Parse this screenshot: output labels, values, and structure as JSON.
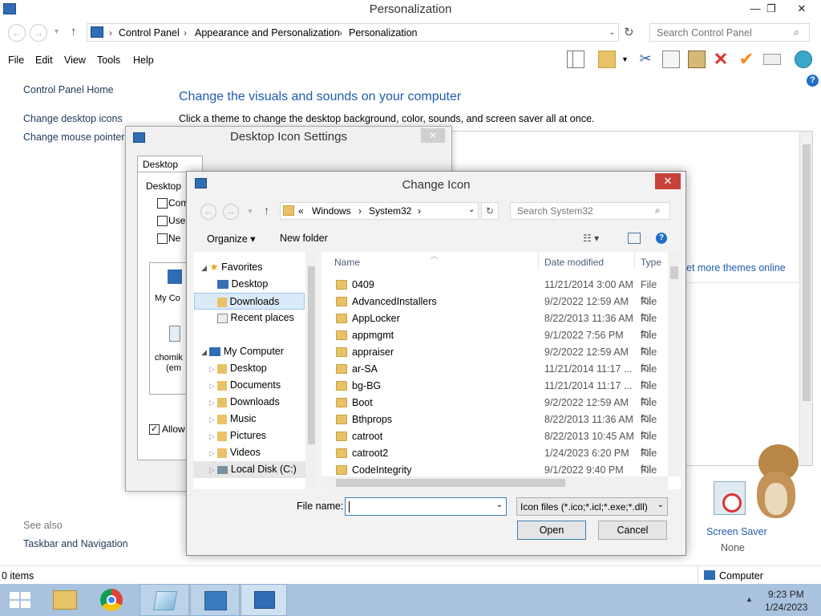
{
  "window": {
    "title": "Personalization",
    "min": "—",
    "max": "❐",
    "close": "✕"
  },
  "address": {
    "crumbs": [
      "Control Panel",
      "Appearance and Personalization",
      "Personalization"
    ],
    "search_placeholder": "Search Control Panel"
  },
  "menu": [
    "File",
    "Edit",
    "View",
    "Tools",
    "Help"
  ],
  "left_pane": {
    "home": "Control Panel Home",
    "links": [
      "Change desktop icons",
      "Change mouse pointers"
    ],
    "see_also": "See also",
    "see_also_links": [
      "Taskbar and Navigation"
    ]
  },
  "main": {
    "heading": "Change the visuals and sounds on your computer",
    "subtext": "Click a theme to change the desktop background, color, sounds, and screen saver all at once.",
    "more_themes": "et more themes online",
    "screensaver_label": "Screen Saver",
    "screensaver_value": "None"
  },
  "desktop_icon_settings": {
    "title": "Desktop Icon Settings",
    "tab": "Desktop Icons",
    "group": "Desktop",
    "checkboxes": [
      "Com",
      "Use",
      "Ne"
    ],
    "icons": [
      "My Co",
      "chomik",
      "(em"
    ],
    "allow": "Allow"
  },
  "change_icon": {
    "title": "Change Icon",
    "path": [
      "«",
      "Windows",
      "System32"
    ],
    "search_placeholder": "Search System32",
    "organize": "Organize",
    "new_folder": "New folder",
    "tree": {
      "favorites": "Favorites",
      "fav_items": [
        "Desktop",
        "Downloads",
        "Recent places"
      ],
      "computer": "My Computer",
      "comp_items": [
        "Desktop",
        "Documents",
        "Downloads",
        "Music",
        "Pictures",
        "Videos",
        "Local Disk (C:)"
      ]
    },
    "columns": {
      "name": "Name",
      "date": "Date modified",
      "type": "Type"
    },
    "files": [
      {
        "name": "0409",
        "date": "11/21/2014 3:00 AM",
        "type": "File fol"
      },
      {
        "name": "AdvancedInstallers",
        "date": "9/2/2022 12:59 AM",
        "type": "File fol"
      },
      {
        "name": "AppLocker",
        "date": "8/22/2013 11:36 AM",
        "type": "File fol"
      },
      {
        "name": "appmgmt",
        "date": "9/1/2022 7:56 PM",
        "type": "File fol"
      },
      {
        "name": "appraiser",
        "date": "9/2/2022 12:59 AM",
        "type": "File fol"
      },
      {
        "name": "ar-SA",
        "date": "11/21/2014 11:17 ...",
        "type": "File fol"
      },
      {
        "name": "bg-BG",
        "date": "11/21/2014 11:17 ...",
        "type": "File fol"
      },
      {
        "name": "Boot",
        "date": "9/2/2022 12:59 AM",
        "type": "File fol"
      },
      {
        "name": "Bthprops",
        "date": "8/22/2013 11:36 AM",
        "type": "File fol"
      },
      {
        "name": "catroot",
        "date": "8/22/2013 10:45 AM",
        "type": "File fol"
      },
      {
        "name": "catroot2",
        "date": "1/24/2023 6:20 PM",
        "type": "File fol"
      },
      {
        "name": "CodeIntegrity",
        "date": "9/1/2022 9:40 PM",
        "type": "File fol"
      }
    ],
    "filename_label": "File name:",
    "filename_value": "",
    "filter": "Icon files (*.ico;*.icl;*.exe;*.dll)",
    "open": "Open",
    "cancel": "Cancel"
  },
  "status": {
    "items": "0 items",
    "computer": "Computer"
  },
  "taskbar": {
    "time": "9:23 PM",
    "date": "1/24/2023"
  }
}
